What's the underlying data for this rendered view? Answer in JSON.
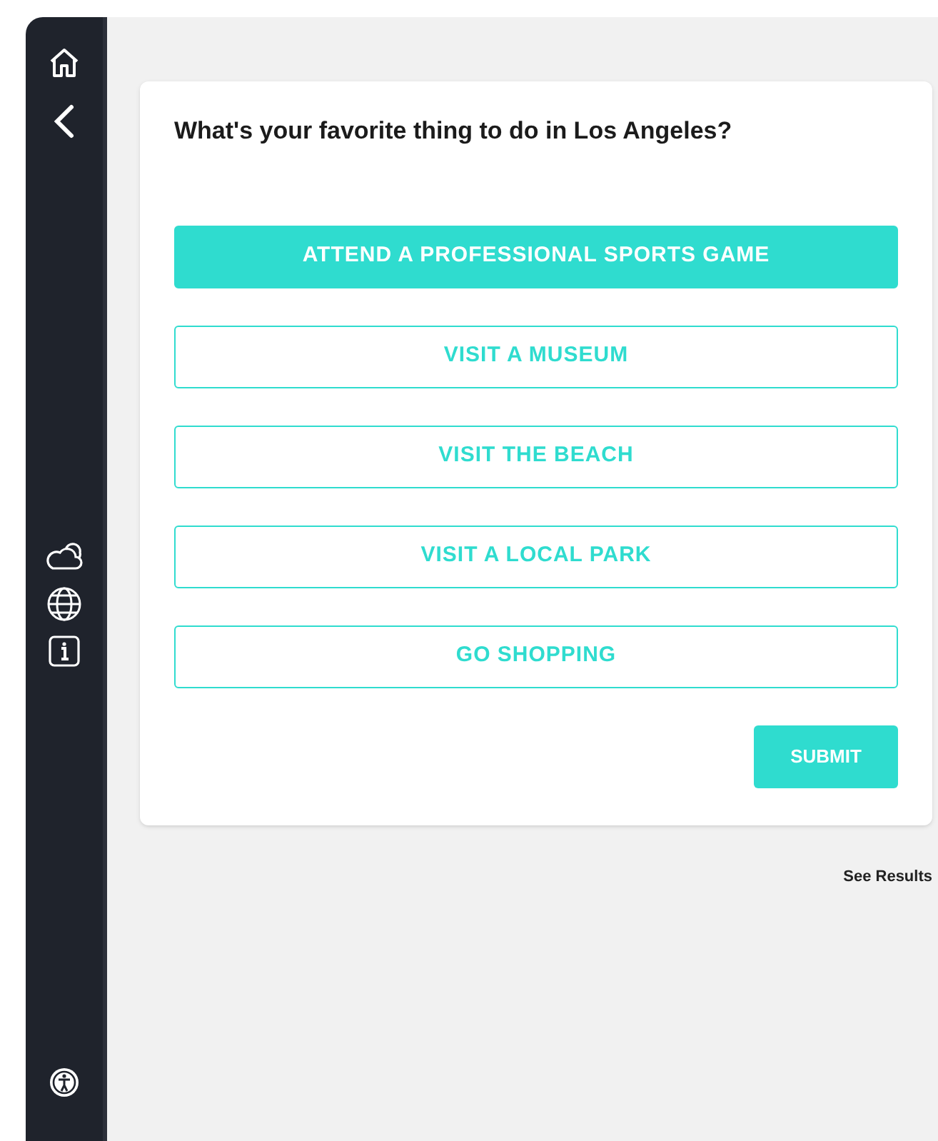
{
  "question": "What's your favorite thing to do in Los Angeles?",
  "options": [
    {
      "label": "ATTEND A PROFESSIONAL SPORTS GAME",
      "selected": true
    },
    {
      "label": "VISIT A MUSEUM",
      "selected": false
    },
    {
      "label": "VISIT THE BEACH",
      "selected": false
    },
    {
      "label": "VISIT A LOCAL PARK",
      "selected": false
    },
    {
      "label": "GO SHOPPING",
      "selected": false
    }
  ],
  "submit": "SUBMIT",
  "see_results": "See Results"
}
